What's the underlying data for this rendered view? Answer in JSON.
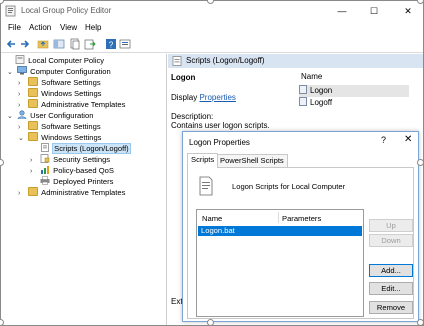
{
  "window": {
    "title": "Local Group Policy Editor",
    "controls": {
      "minimize": "—",
      "maximize": "☐",
      "close": "✕"
    }
  },
  "menu": [
    "File",
    "Action",
    "View",
    "Help"
  ],
  "toolbar": {
    "icons": [
      "back-arrow-icon",
      "forward-arrow-icon",
      "up-folder-icon",
      "show-hide-tree-icon",
      "copy-icon",
      "export-icon",
      "help-icon",
      "properties-icon"
    ]
  },
  "tree": {
    "items": [
      {
        "label": "Local Computer Policy",
        "chev": "",
        "icon": "policy-icon"
      },
      {
        "label": "Computer Configuration",
        "chev": "⌄",
        "icon": "computer-icon"
      },
      {
        "label": "Software Settings",
        "chev": "›",
        "icon": "folder-icon"
      },
      {
        "label": "Windows Settings",
        "chev": "›",
        "icon": "folder-icon"
      },
      {
        "label": "Administrative Templates",
        "chev": "›",
        "icon": "folder-icon"
      },
      {
        "label": "User Configuration",
        "chev": "⌄",
        "icon": "user-icon"
      },
      {
        "label": "Software Settings",
        "chev": "›",
        "icon": "folder-icon"
      },
      {
        "label": "Windows Settings",
        "chev": "⌄",
        "icon": "folder-icon"
      },
      {
        "label": "Scripts (Logon/Logoff)",
        "chev": "",
        "icon": "script-icon"
      },
      {
        "label": "Security Settings",
        "chev": "›",
        "icon": "security-icon"
      },
      {
        "label": "Policy-based QoS",
        "chev": "›",
        "icon": "qos-chart-icon"
      },
      {
        "label": "Deployed Printers",
        "chev": "",
        "icon": "printer-icon"
      },
      {
        "label": "Administrative Templates",
        "chev": "›",
        "icon": "folder-icon"
      }
    ]
  },
  "detail": {
    "header": "Scripts (Logon/Logoff)",
    "item_title": "Logon",
    "display_prefix": "Display",
    "display_link": "Properties",
    "description_label": "Description:",
    "description_text": "Contains user logon scripts.",
    "list_header": "Name",
    "list_items": [
      "Logon",
      "Logoff"
    ],
    "bottom_tab": "Ext"
  },
  "dialog": {
    "title": "Logon Properties",
    "help": "?",
    "close": "✕",
    "tabs": [
      "Scripts",
      "PowerShell Scripts"
    ],
    "section_title": "Logon Scripts for Local Computer",
    "columns": [
      "Name",
      "Parameters"
    ],
    "rows": [
      "Logon.bat"
    ],
    "buttons": {
      "up": "Up",
      "down": "Down",
      "add": "Add...",
      "edit": "Edit...",
      "remove": "Remove"
    }
  },
  "colors": {
    "selection": "#0078d7",
    "header_band": "#d9e4f2",
    "link": "#1a5ab0"
  }
}
